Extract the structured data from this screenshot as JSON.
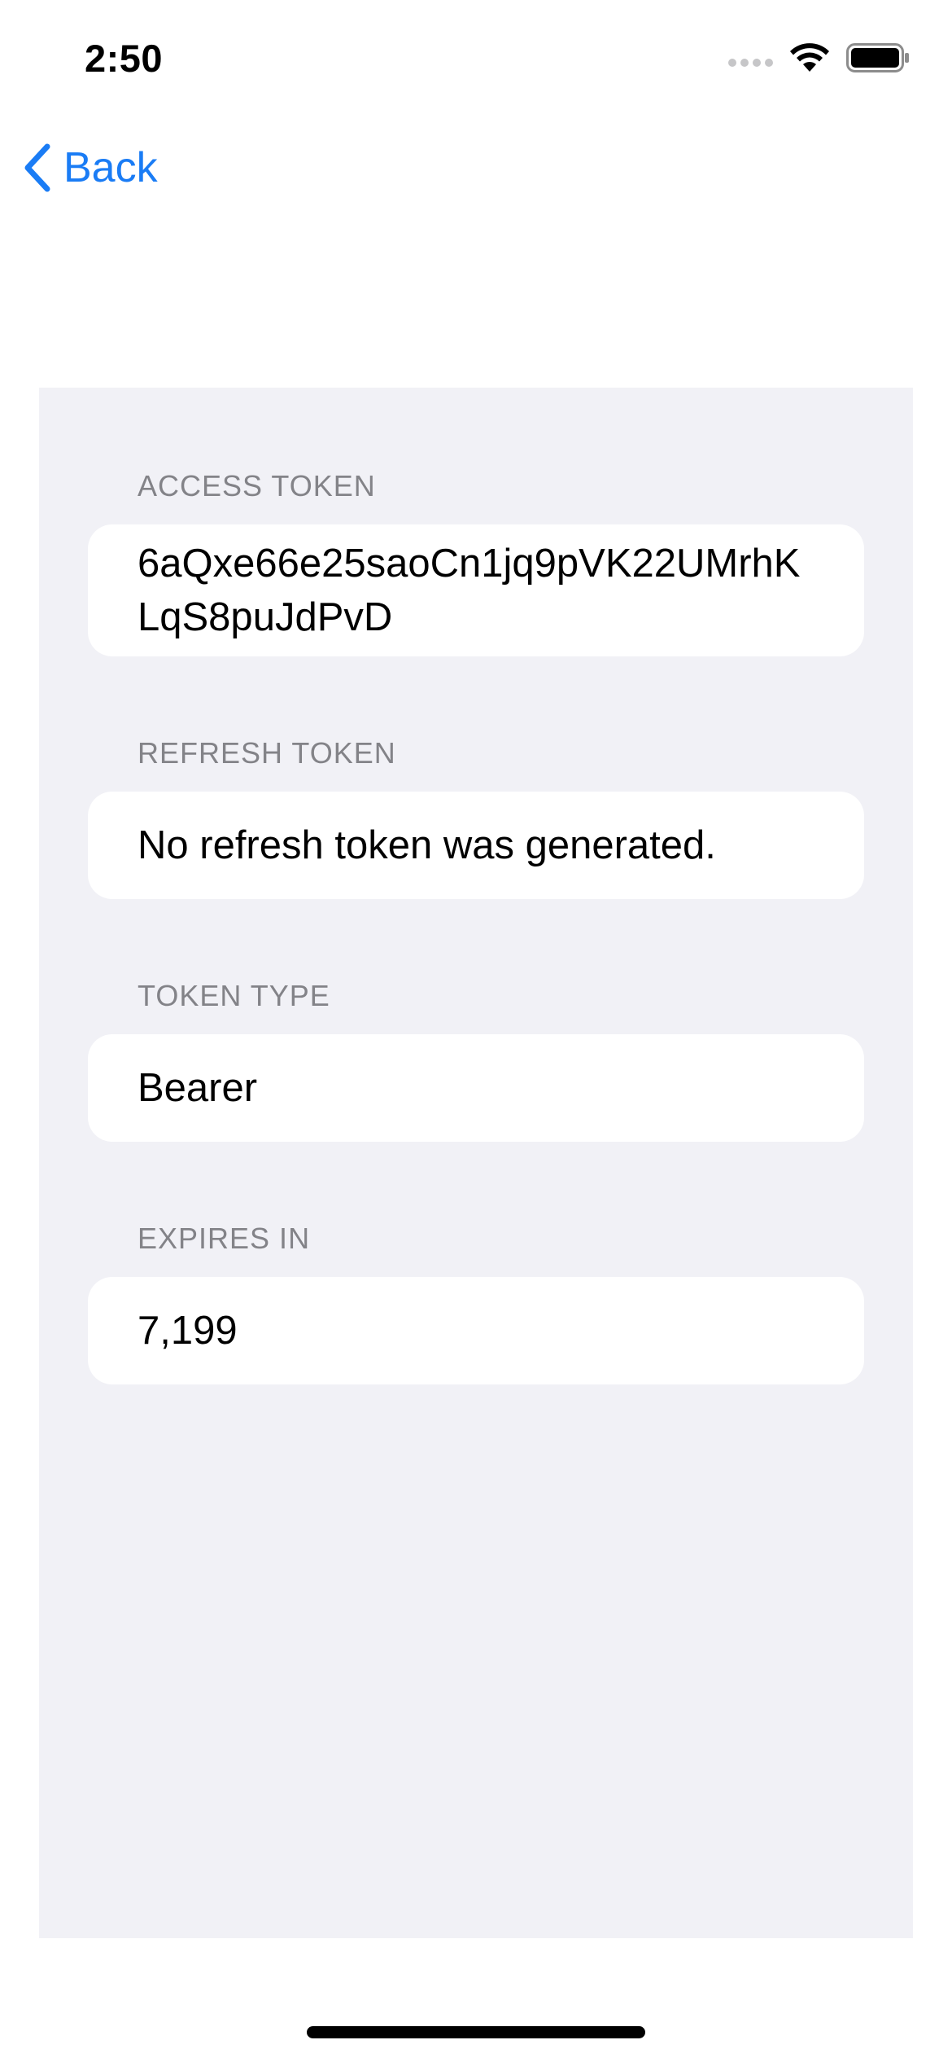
{
  "status_bar": {
    "time": "2:50"
  },
  "nav": {
    "back_label": "Back",
    "accent_color": "#1a7cf5"
  },
  "sections": [
    {
      "header": "ACCESS TOKEN",
      "value": "6aQxe66e25saoCn1jq9pVK22UMrhKLqS8puJdPvD"
    },
    {
      "header": "REFRESH TOKEN",
      "value": "No refresh token was generated."
    },
    {
      "header": "TOKEN TYPE",
      "value": "Bearer"
    },
    {
      "header": "EXPIRES IN",
      "value": "7,199"
    }
  ],
  "icons": {
    "signal": "cellular-signal-icon",
    "wifi": "wifi-icon",
    "battery": "battery-icon",
    "back": "chevron-left-icon"
  }
}
